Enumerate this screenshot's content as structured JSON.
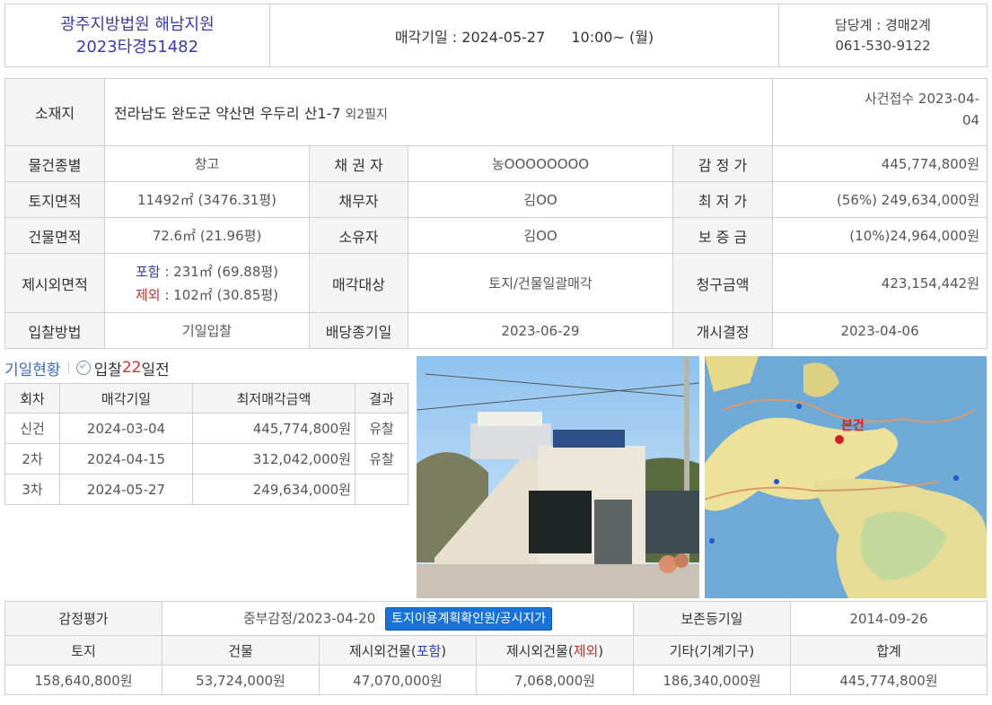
{
  "header": {
    "court": "광주지방법원 해남지원",
    "case_no": "2023타경51482",
    "sale_date_label": "매각기일 : 2024-05-27",
    "sale_time": "10:00~ (월)",
    "dept": "담당계 : 경매2계",
    "phone": "061-530-9122"
  },
  "info": {
    "location_label": "소재지",
    "address": "전라남도 완도군 약산면 우두리 산1-7",
    "address_extra": "외2필지",
    "receipt_label": "사건접수 2023-04-",
    "receipt_tail": "04",
    "rows": [
      {
        "l1": "물건종별",
        "v1": "창고",
        "l2": "채 권 자",
        "v2": "농OOOOOOOO",
        "l3": "감 정 가",
        "v3": "445,774,800원"
      },
      {
        "l1": "토지면적",
        "v1": "11492㎡ (3476.31평)",
        "l2": "채무자",
        "v2": "김OO",
        "l3": "최 저 가",
        "v3": "(56%) 249,634,000원"
      },
      {
        "l1": "건물면적",
        "v1": "72.6㎡ (21.96평)",
        "l2": "소유자",
        "v2": "김OO",
        "l3": "보 증 금",
        "v3": "(10%)24,964,000원"
      },
      {
        "l1": "제시외면적",
        "l2": "매각대상",
        "v2": "토지/건물일괄매각",
        "l3": "청구금액",
        "v3": "423,154,442원"
      },
      {
        "l1": "입찰방법",
        "v1": "기일입찰",
        "l2": "배당종기일",
        "v2": "2023-06-29",
        "l3": "개시결정",
        "v3": "2023-04-06"
      }
    ],
    "extra_area": {
      "incl_label": "포함",
      "incl_value": " : 231㎡ (69.88평)",
      "excl_label": "제외",
      "excl_value": " : 102㎡ (30.85평)"
    }
  },
  "schedule": {
    "title": "기일현황",
    "bid_prefix": "입찰",
    "bid_days": "22",
    "bid_suffix": "일전",
    "headers": [
      "회차",
      "매각기일",
      "최저매각금액",
      "결과"
    ],
    "rows": [
      [
        "신건",
        "2024-03-04",
        "445,774,800원",
        "유찰"
      ],
      [
        "2차",
        "2024-04-15",
        "312,042,000원",
        "유찰"
      ],
      [
        "3차",
        "2024-05-27",
        "249,634,000원",
        ""
      ]
    ]
  },
  "map": {
    "marker_label": "본건"
  },
  "appraisal": {
    "label": "감정평가",
    "agency": "중부감정/2023-04-20",
    "button": "토지이용계획확인원/공시지가",
    "preserve_label": "보존등기일",
    "preserve_date": "2014-09-26",
    "headers": [
      "토지",
      "건물",
      "제시외건물(",
      "포함",
      ")",
      "제시외건물(",
      "제외",
      ")",
      "기타(기계기구)",
      "합계"
    ],
    "values": [
      "158,640,800원",
      "53,724,000원",
      "47,070,000원",
      "7,068,000원",
      "186,340,000원",
      "445,774,800원"
    ]
  },
  "colors": {
    "accent": "#1a72d6",
    "court": "#3a3aa8",
    "red": "#b33333",
    "blue": "#3a6ac0"
  }
}
